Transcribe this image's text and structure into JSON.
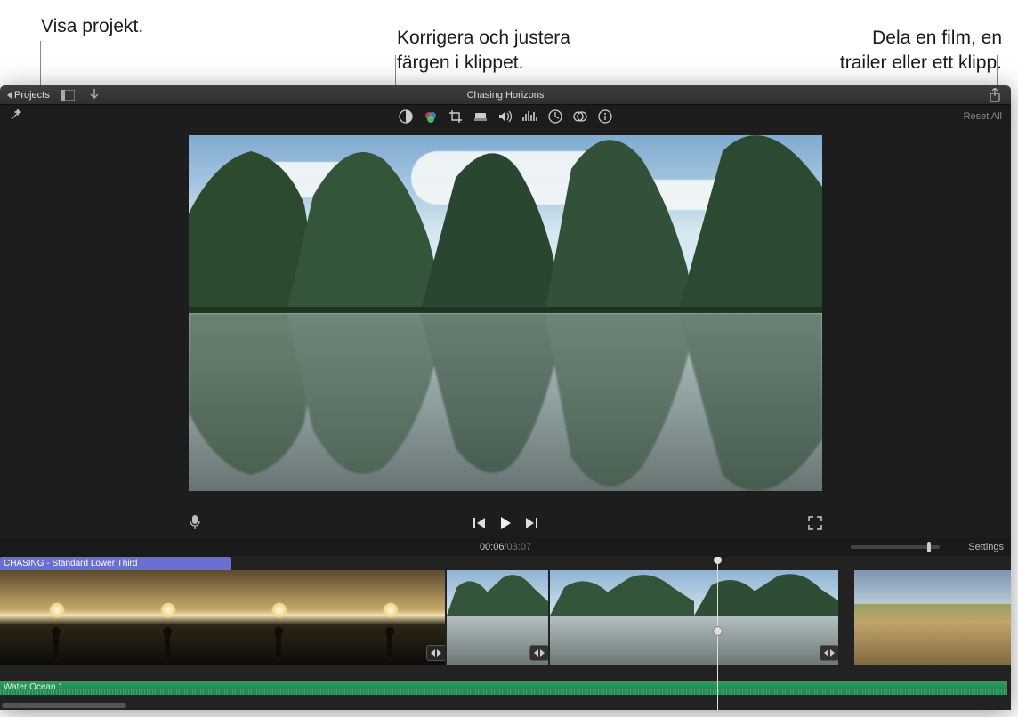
{
  "callouts": {
    "projects": "Visa projekt.",
    "color": "Korrigera och justera\nfärgen i klippet.",
    "share": "Dela en film, en\ntrailer eller ett klipp."
  },
  "toolbar": {
    "projects_label": "Projects",
    "title": "Chasing Horizons"
  },
  "inspector": {
    "reset_label": "Reset All"
  },
  "timecode": {
    "current": "00:06",
    "separator": " / ",
    "duration": "03:07",
    "settings_label": "Settings"
  },
  "timeline": {
    "title_clip": "CHASING - Standard Lower Third",
    "audio_clip": "Water Ocean 1"
  },
  "icons": {
    "magic_wand": "magic-wand-icon",
    "color_balance": "color-balance-icon",
    "color_correction": "color-correction-icon",
    "crop": "crop-icon",
    "stabilize": "stabilize-icon",
    "volume": "volume-icon",
    "noise": "noise-reduction-icon",
    "speed": "speed-icon",
    "filter": "filter-icon",
    "info": "info-icon"
  }
}
